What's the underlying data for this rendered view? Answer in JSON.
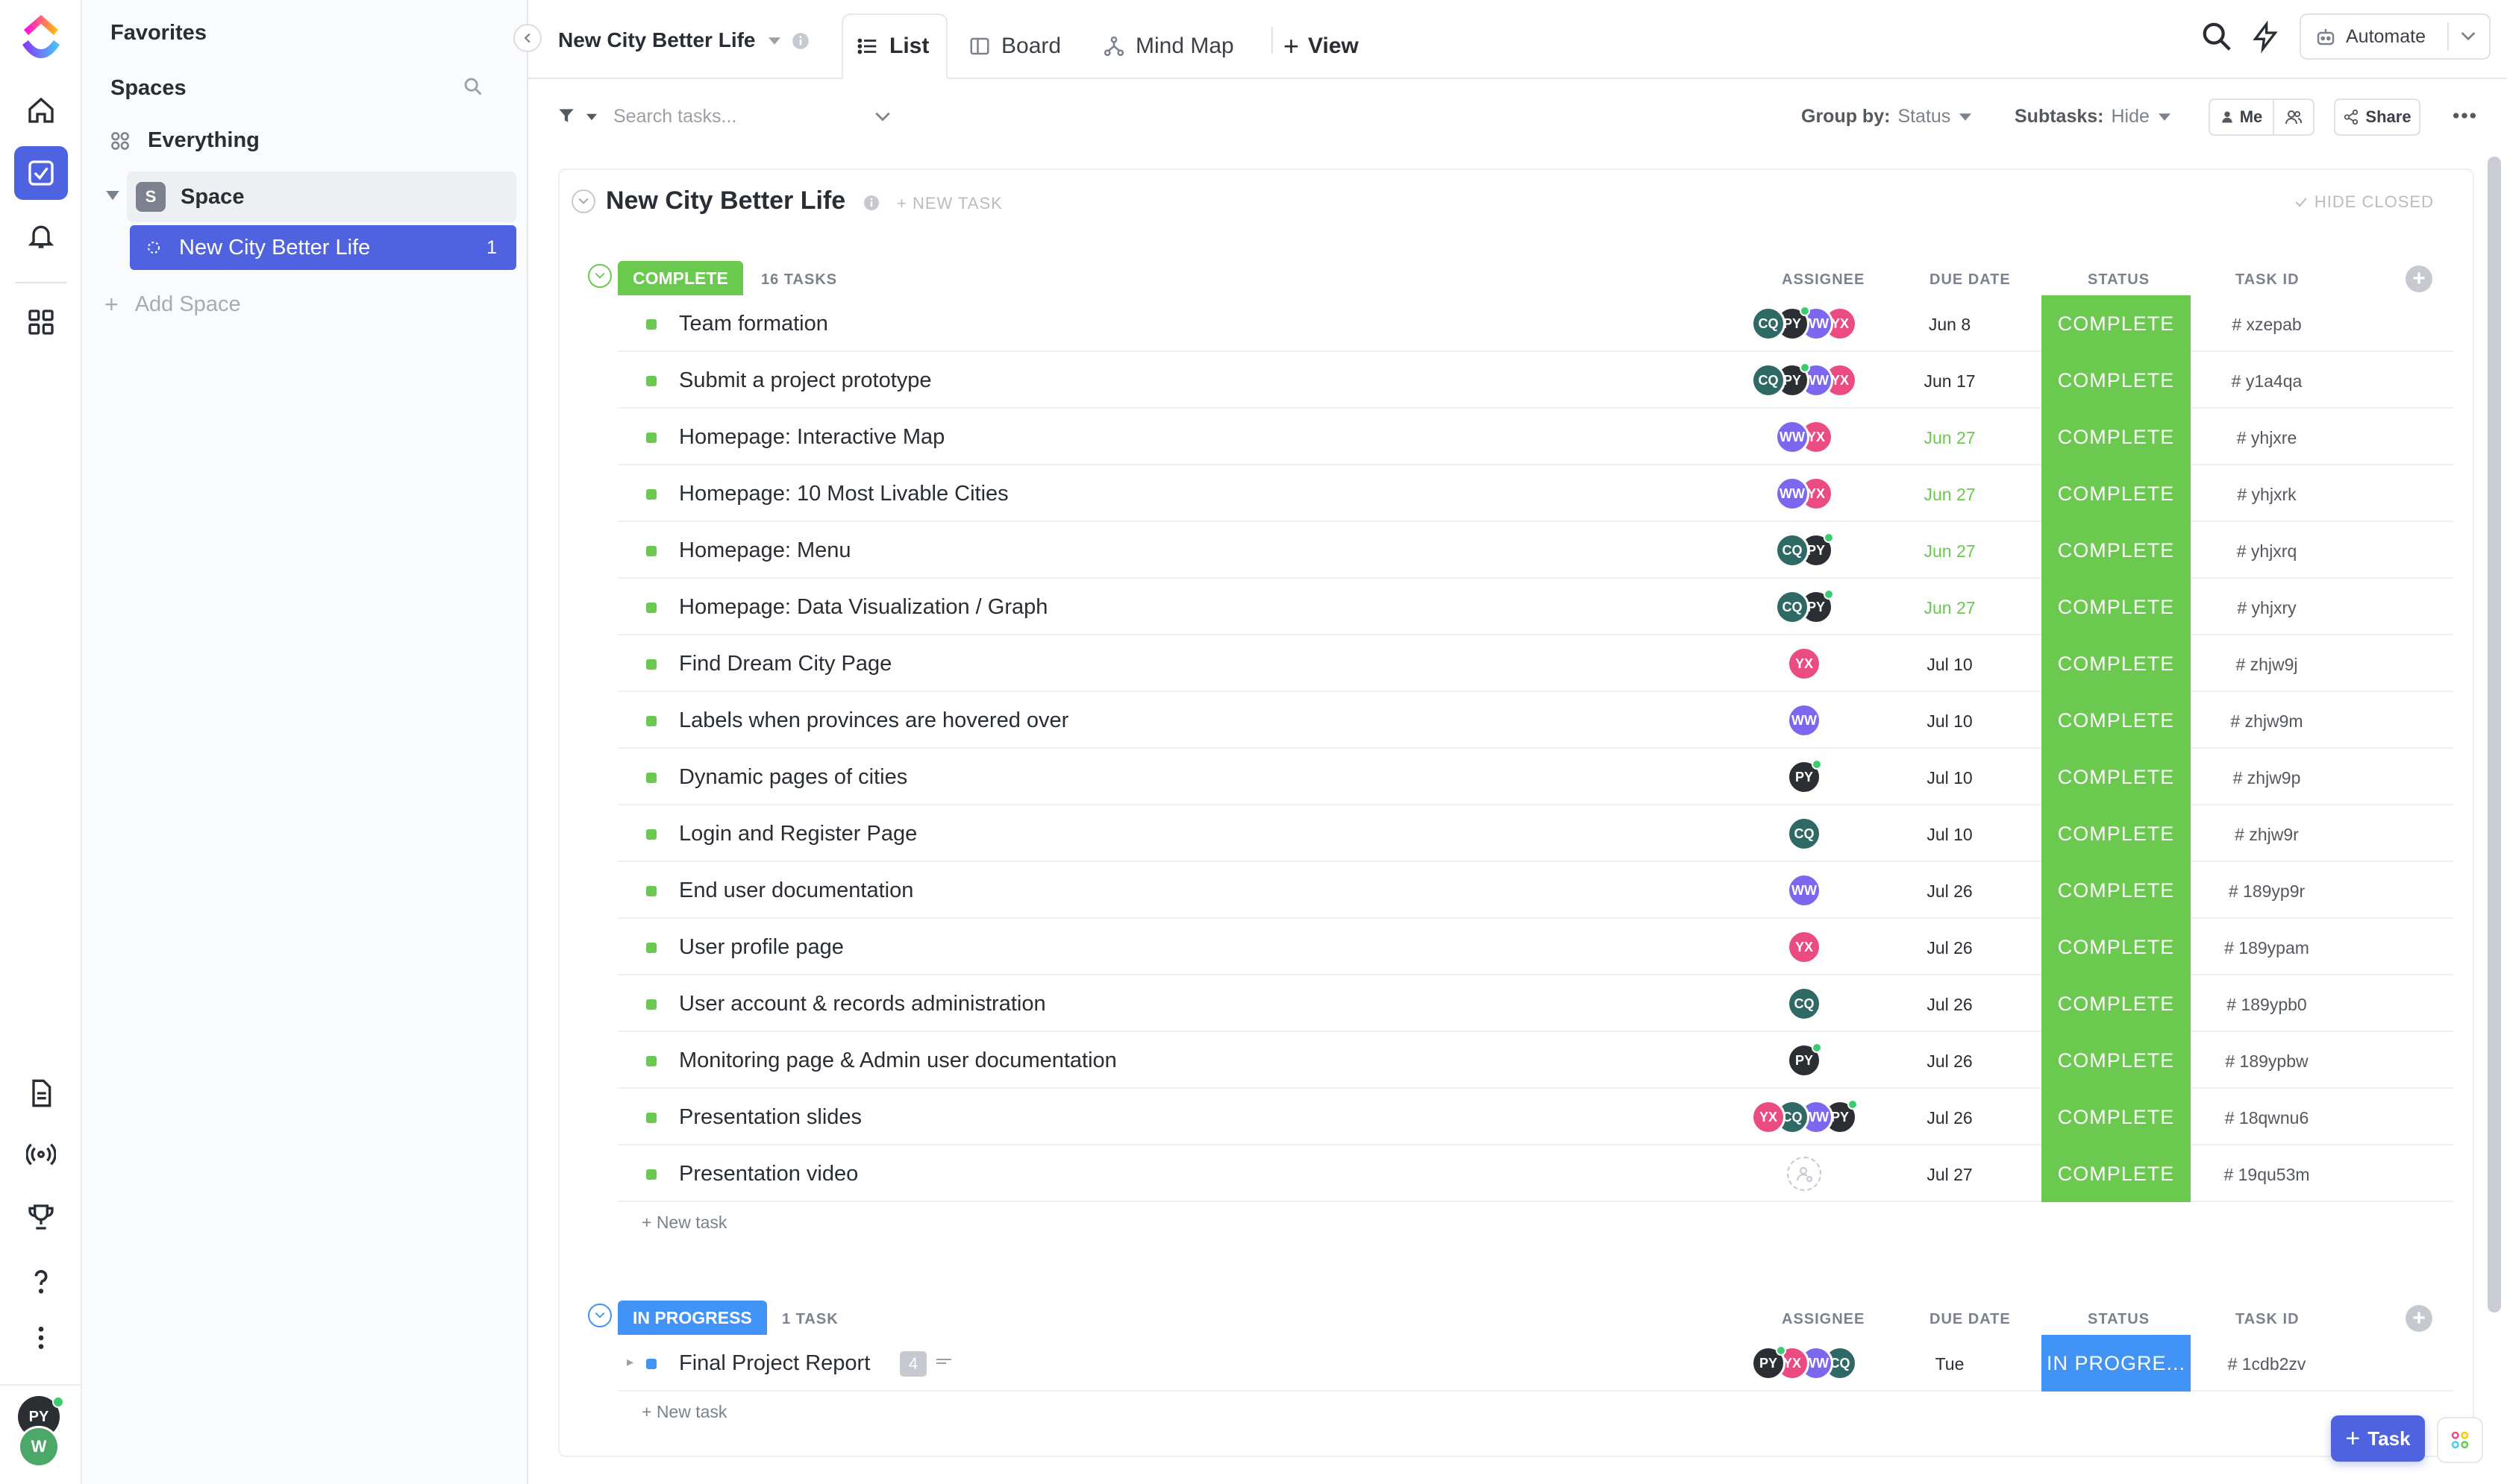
{
  "sidebar": {
    "favorites": "Favorites",
    "spaces": "Spaces",
    "everything": "Everything",
    "space_avatar": "S",
    "space_name": "Space",
    "list_name": "New City Better Life",
    "list_count": "1",
    "add_space": "Add Space"
  },
  "rail": {
    "user1_initials": "PY",
    "user2_initials": "W",
    "active_color": "#4f63e0"
  },
  "topbar": {
    "title": "New City Better Life",
    "tabs": [
      "List",
      "Board",
      "Mind Map"
    ],
    "add_view": "View",
    "automate": "Automate"
  },
  "filterbar": {
    "search_placeholder": "Search tasks...",
    "group_by_label": "Group by:",
    "group_by_value": "Status",
    "subtasks_label": "Subtasks:",
    "subtasks_value": "Hide",
    "me": "Me",
    "share": "Share"
  },
  "main": {
    "list_title": "New City Better Life",
    "new_task_header": "+ NEW TASK",
    "hide_closed": "HIDE CLOSED",
    "columns": {
      "assignee": "ASSIGNEE",
      "due": "DUE DATE",
      "status": "STATUS",
      "task_id": "TASK ID"
    },
    "new_task_link": "+ New task"
  },
  "colors": {
    "complete": "#6bc950",
    "in_progress": "#4194f6",
    "accent": "#4f63e0",
    "overdue_green": "#6bc950"
  },
  "people": {
    "CQ": "#2f6966",
    "PY": "#2b2f33",
    "WW": "#7b68ee",
    "YX": "#ea4b83"
  },
  "groups": {
    "complete": {
      "label": "COMPLETE",
      "count": "16 TASKS",
      "tasks": [
        {
          "name": "Team formation",
          "assignees": [
            "CQ",
            "PY",
            "WW",
            "YX"
          ],
          "due": "Jun 8",
          "due_green": false,
          "status": "COMPLETE",
          "id": "# xzepab"
        },
        {
          "name": "Submit a project prototype",
          "assignees": [
            "CQ",
            "PY",
            "WW",
            "YX"
          ],
          "due": "Jun 17",
          "due_green": false,
          "status": "COMPLETE",
          "id": "# y1a4qa"
        },
        {
          "name": "Homepage: Interactive Map",
          "assignees": [
            "WW",
            "YX"
          ],
          "due": "Jun 27",
          "due_green": true,
          "status": "COMPLETE",
          "id": "# yhjxre"
        },
        {
          "name": "Homepage: 10 Most Livable Cities",
          "assignees": [
            "WW",
            "YX"
          ],
          "due": "Jun 27",
          "due_green": true,
          "status": "COMPLETE",
          "id": "# yhjxrk"
        },
        {
          "name": "Homepage: Menu",
          "assignees": [
            "CQ",
            "PY"
          ],
          "due": "Jun 27",
          "due_green": true,
          "status": "COMPLETE",
          "id": "# yhjxrq"
        },
        {
          "name": "Homepage: Data Visualization / Graph",
          "assignees": [
            "CQ",
            "PY"
          ],
          "due": "Jun 27",
          "due_green": true,
          "status": "COMPLETE",
          "id": "# yhjxry"
        },
        {
          "name": "Find Dream City Page",
          "assignees": [
            "YX"
          ],
          "due": "Jul 10",
          "due_green": false,
          "status": "COMPLETE",
          "id": "# zhjw9j"
        },
        {
          "name": "Labels when provinces are hovered over",
          "assignees": [
            "WW"
          ],
          "due": "Jul 10",
          "due_green": false,
          "status": "COMPLETE",
          "id": "# zhjw9m"
        },
        {
          "name": "Dynamic pages of cities",
          "assignees": [
            "PY"
          ],
          "due": "Jul 10",
          "due_green": false,
          "status": "COMPLETE",
          "id": "# zhjw9p"
        },
        {
          "name": "Login and Register Page",
          "assignees": [
            "CQ"
          ],
          "due": "Jul 10",
          "due_green": false,
          "status": "COMPLETE",
          "id": "# zhjw9r"
        },
        {
          "name": "End user documentation",
          "assignees": [
            "WW"
          ],
          "due": "Jul 26",
          "due_green": false,
          "status": "COMPLETE",
          "id": "# 189yp9r"
        },
        {
          "name": "User profile page",
          "assignees": [
            "YX"
          ],
          "due": "Jul 26",
          "due_green": false,
          "status": "COMPLETE",
          "id": "# 189ypam"
        },
        {
          "name": "User account & records administration",
          "assignees": [
            "CQ"
          ],
          "due": "Jul 26",
          "due_green": false,
          "status": "COMPLETE",
          "id": "# 189ypb0"
        },
        {
          "name": "Monitoring page & Admin user documentation",
          "assignees": [
            "PY"
          ],
          "due": "Jul 26",
          "due_green": false,
          "status": "COMPLETE",
          "id": "# 189ypbw"
        },
        {
          "name": "Presentation slides",
          "assignees": [
            "YX",
            "CQ",
            "WW",
            "PY"
          ],
          "due": "Jul 26",
          "due_green": false,
          "status": "COMPLETE",
          "id": "# 18qwnu6"
        },
        {
          "name": "Presentation video",
          "assignees": [],
          "due": "Jul 27",
          "due_green": false,
          "status": "COMPLETE",
          "id": "# 19qu53m"
        }
      ]
    },
    "in_progress": {
      "label": "IN PROGRESS",
      "count": "1 TASK",
      "tasks": [
        {
          "name": "Final Project Report",
          "subtask_count": "4",
          "assignees": [
            "PY",
            "YX",
            "WW",
            "CQ"
          ],
          "due": "Tue",
          "due_green": false,
          "status": "IN PROGRE...",
          "id": "# 1cdb2zv"
        }
      ]
    }
  },
  "fab": {
    "task": "Task"
  }
}
